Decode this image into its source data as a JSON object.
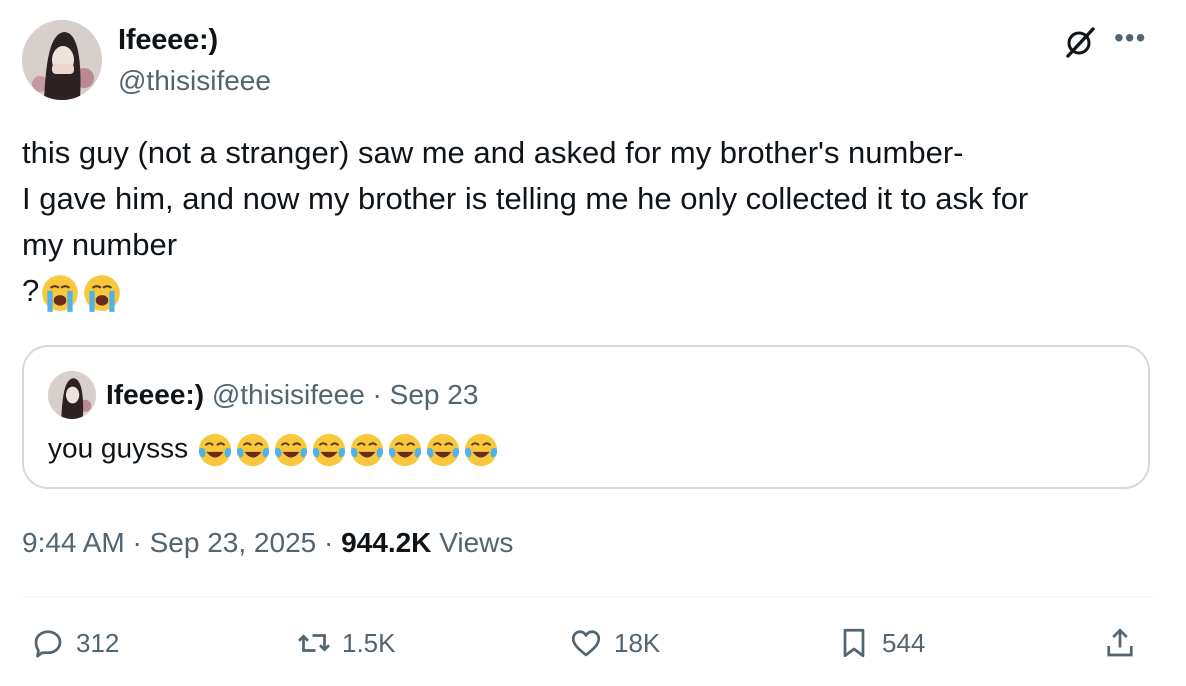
{
  "author": {
    "name": "Ifeeee:)",
    "handle": "@thisisifeee"
  },
  "tweet": {
    "lines": [
      "this guy (not a stranger) saw me and asked for my brother's number-",
      "I gave him, and now my brother is telling me he only collected it to ask for",
      "my number",
      "?"
    ]
  },
  "quote": {
    "name": "Ifeeee:)",
    "handle": "@thisisifeee",
    "separator": "·",
    "date": "Sep 23",
    "text": "you guysss"
  },
  "meta": {
    "time": "9:44 AM",
    "sep1": "·",
    "date": "Sep 23, 2025",
    "sep2": "·",
    "views_count": "944.2K",
    "views_label": "Views"
  },
  "actions": {
    "replies": "312",
    "reposts": "1.5K",
    "likes": "18K",
    "bookmarks": "544"
  },
  "icons": {
    "grok": "grok-icon",
    "more": "more-icon",
    "reply": "reply-icon",
    "repost": "repost-icon",
    "like": "heart-icon",
    "bookmark": "bookmark-icon",
    "share": "share-icon"
  },
  "colors": {
    "text": "#0f1419",
    "secondary": "#536471",
    "border": "#cfd9de"
  }
}
